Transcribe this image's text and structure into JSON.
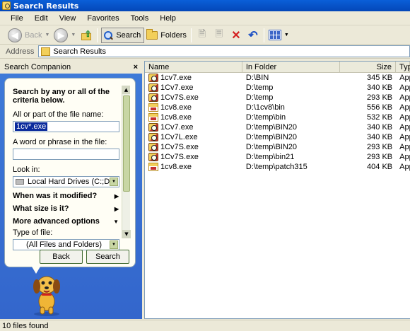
{
  "window": {
    "title": "Search Results"
  },
  "menu": [
    "File",
    "Edit",
    "View",
    "Favorites",
    "Tools",
    "Help"
  ],
  "toolbar": {
    "back_label": "Back",
    "search_label": "Search",
    "folders_label": "Folders"
  },
  "address": {
    "label": "Address",
    "value": "Search Results"
  },
  "companion": {
    "title": "Search Companion",
    "close": "×",
    "heading": "Search by any or all of the criteria below.",
    "filename_label": "All or part of the file name:",
    "filename_value": "1cv*.exe",
    "phrase_label": "A word or phrase in the file:",
    "phrase_value": "",
    "lookin_label": "Look in:",
    "lookin_value": "Local Hard Drives (C:;D:)",
    "modified_label": "When was it modified?",
    "size_label": "What size is it?",
    "advanced_label": "More advanced options",
    "type_label": "Type of file:",
    "type_value": "(All Files and Folders)",
    "back_button": "Back",
    "search_button": "Search"
  },
  "results": {
    "columns": [
      "Name",
      "In Folder",
      "Size",
      "Typ"
    ],
    "rows": [
      {
        "name": "1cv7.exe",
        "folder": "D:\\BIN",
        "size": "345 KB",
        "type": "App",
        "icon": "app-icon-a"
      },
      {
        "name": "1Cv7.exe",
        "folder": "D:\\temp",
        "size": "340 KB",
        "type": "App",
        "icon": "app-icon-a"
      },
      {
        "name": "1Cv7S.exe",
        "folder": "D:\\temp",
        "size": "293 KB",
        "type": "App",
        "icon": "app-icon-a"
      },
      {
        "name": "1cv8.exe",
        "folder": "D:\\1cv8\\bin",
        "size": "556 KB",
        "type": "App",
        "icon": "app-icon-b"
      },
      {
        "name": "1cv8.exe",
        "folder": "D:\\temp\\bin",
        "size": "532 KB",
        "type": "App",
        "icon": "app-icon-b"
      },
      {
        "name": "1Cv7.exe",
        "folder": "D:\\temp\\BIN20",
        "size": "340 KB",
        "type": "App",
        "icon": "app-icon-a"
      },
      {
        "name": "1Cv7L.exe",
        "folder": "D:\\temp\\BIN20",
        "size": "340 KB",
        "type": "App",
        "icon": "app-icon-a"
      },
      {
        "name": "1Cv7S.exe",
        "folder": "D:\\temp\\BIN20",
        "size": "293 KB",
        "type": "App",
        "icon": "app-icon-a"
      },
      {
        "name": "1Cv7S.exe",
        "folder": "D:\\temp\\bin21",
        "size": "293 KB",
        "type": "App",
        "icon": "app-icon-a"
      },
      {
        "name": "1cv8.exe",
        "folder": "D:\\temp\\patch315",
        "size": "404 KB",
        "type": "App",
        "icon": "app-icon-b"
      }
    ]
  },
  "status": {
    "text": "10 files found"
  },
  "colors": {
    "title_bar": "#0a5fd8",
    "companion_bg": "#3366cc",
    "selection": "#0b2b9c"
  }
}
